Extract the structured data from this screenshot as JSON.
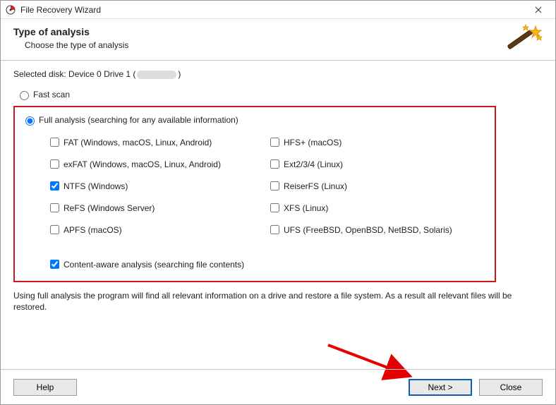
{
  "titlebar": {
    "title": "File Recovery Wizard"
  },
  "header": {
    "title": "Type of analysis",
    "subtitle": "Choose the type of analysis"
  },
  "selected_disk": {
    "prefix": "Selected disk: ",
    "value_before": "Device 0 Drive 1 (",
    "value_after": ")"
  },
  "analysis": {
    "fast_label": "Fast scan",
    "full_label": "Full analysis (searching for any available information)",
    "selected": "full",
    "content_aware_label": "Content-aware analysis (searching file contents)",
    "content_aware_checked": true
  },
  "fs": {
    "left": [
      {
        "label": "FAT (Windows, macOS, Linux, Android)",
        "checked": false
      },
      {
        "label": "exFAT (Windows, macOS, Linux, Android)",
        "checked": false
      },
      {
        "label": "NTFS (Windows)",
        "checked": true
      },
      {
        "label": "ReFS (Windows Server)",
        "checked": false
      },
      {
        "label": "APFS (macOS)",
        "checked": false
      }
    ],
    "right": [
      {
        "label": "HFS+ (macOS)",
        "checked": false
      },
      {
        "label": "Ext2/3/4 (Linux)",
        "checked": false
      },
      {
        "label": "ReiserFS (Linux)",
        "checked": false
      },
      {
        "label": "XFS (Linux)",
        "checked": false
      },
      {
        "label": "UFS (FreeBSD, OpenBSD, NetBSD, Solaris)",
        "checked": false
      }
    ]
  },
  "description": "Using full analysis the program will find all relevant information on a drive and restore a file system. As a result all relevant files will be restored.",
  "buttons": {
    "help": "Help",
    "next": "Next >",
    "close": "Close"
  }
}
